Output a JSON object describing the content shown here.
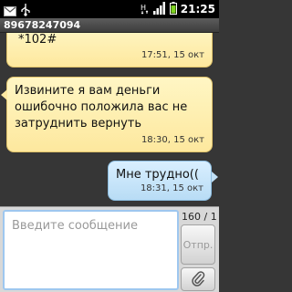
{
  "statusbar": {
    "time": "21:25"
  },
  "header": {
    "title": "89678247094"
  },
  "messages": [
    {
      "direction": "in",
      "text": "*102#",
      "time": "17:51, 15 окт"
    },
    {
      "direction": "in",
      "text": "Извините я вам деньги ошибочно положила вас не затруднить вернуть",
      "time": "18:30, 15 окт"
    },
    {
      "direction": "out",
      "text": "Мне трудно((",
      "time": "18:31, 15 окт"
    }
  ],
  "compose": {
    "placeholder": "Введите сообщение",
    "counter": "160 / 1",
    "send_label": "Отпр."
  },
  "colors": {
    "incoming": "#fde89e",
    "outgoing": "#b8dcf5",
    "input_focus": "#9ec7ef"
  }
}
